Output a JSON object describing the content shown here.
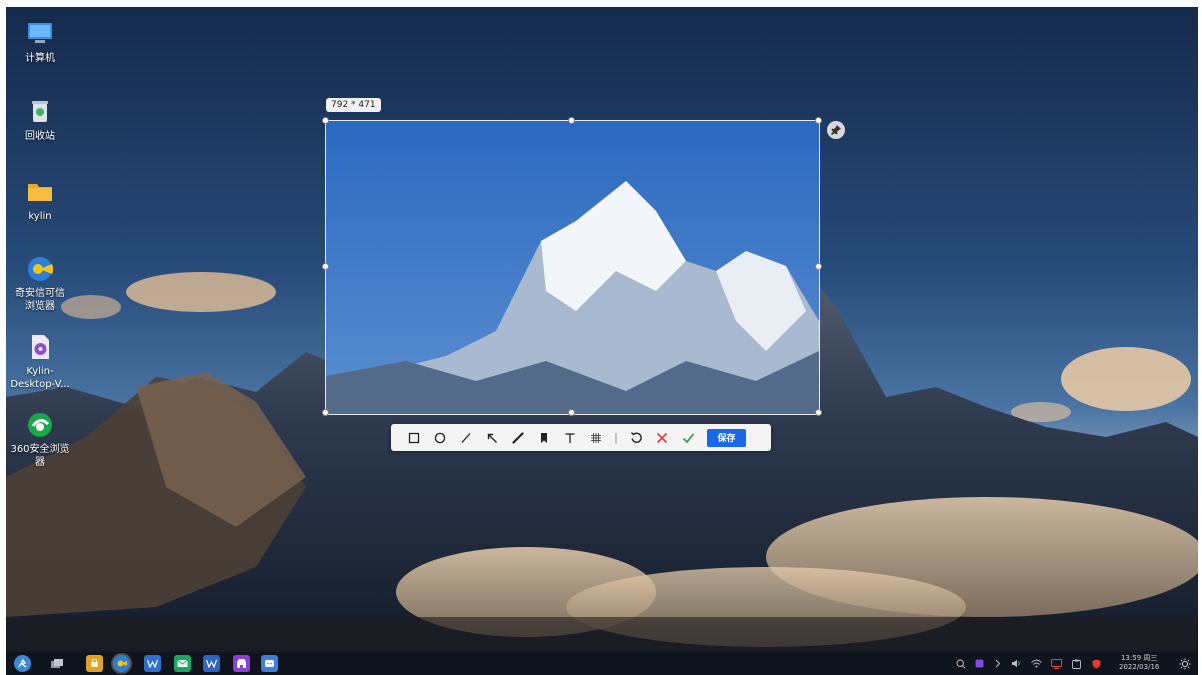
{
  "desktop": {
    "icons": [
      {
        "label": "计算机",
        "icon": "computer-icon"
      },
      {
        "label": "回收站",
        "icon": "trash-icon"
      },
      {
        "label": "kylin",
        "icon": "folder-icon"
      },
      {
        "label": "奇安信可信\n浏览器",
        "icon": "browser-qax-icon"
      },
      {
        "label": "Kylin-\nDesktop-V...",
        "icon": "disc-image-icon"
      },
      {
        "label": "360安全浏览\n器",
        "icon": "browser-360-icon"
      }
    ]
  },
  "screenshot_tool": {
    "size_label": "792 * 471",
    "pin_icon": "pin-icon",
    "tools": [
      {
        "name": "rectangle-tool",
        "icon": "square-icon"
      },
      {
        "name": "ellipse-tool",
        "icon": "circle-icon"
      },
      {
        "name": "line-tool",
        "icon": "line-icon"
      },
      {
        "name": "arrow-tool",
        "icon": "arrow-icon"
      },
      {
        "name": "pen-tool",
        "icon": "pen-icon"
      },
      {
        "name": "marker-tool",
        "icon": "bookmark-icon"
      },
      {
        "name": "text-tool",
        "icon": "text-icon"
      },
      {
        "name": "mosaic-tool",
        "icon": "mosaic-icon"
      }
    ],
    "separator": "|",
    "undo_icon": "undo-icon",
    "cancel_icon": "close-icon",
    "confirm_icon": "check-icon",
    "save_label": "保存",
    "colors": {
      "save_button": "#1769ea",
      "cancel": "#e53935",
      "confirm": "#43a047"
    }
  },
  "taskbar": {
    "apps": [
      {
        "name": "start-menu",
        "icon": "kylin-start-icon",
        "color": "#3e86d6"
      },
      {
        "name": "multitask-view",
        "icon": "windows-icon",
        "color": "#9aa4b2"
      },
      {
        "name": "app-store",
        "icon": "store-icon",
        "color": "#e3a12a"
      },
      {
        "name": "browser",
        "icon": "browser-qax-icon",
        "color": "#2d7fd6"
      },
      {
        "name": "wps-writer",
        "icon": "wps-icon",
        "color": "#2f6fd0"
      },
      {
        "name": "mail",
        "icon": "mail-icon",
        "color": "#1fa463"
      },
      {
        "name": "wps-office",
        "icon": "wps-w-icon",
        "color": "#2e64c4"
      },
      {
        "name": "software-center",
        "icon": "software-icon",
        "color": "#8b3fd6"
      },
      {
        "name": "chat",
        "icon": "chat-icon",
        "color": "#3b7fd9"
      }
    ],
    "tray": [
      "search-icon",
      "assistant-icon",
      "chevron-icon",
      "volume-icon",
      "wifi-icon",
      "notification-icon",
      "clipboard-icon",
      "security-icon"
    ],
    "time": "13:59 周三",
    "date": "2022/03/16",
    "show_desktop_icon": "sun-icon"
  }
}
